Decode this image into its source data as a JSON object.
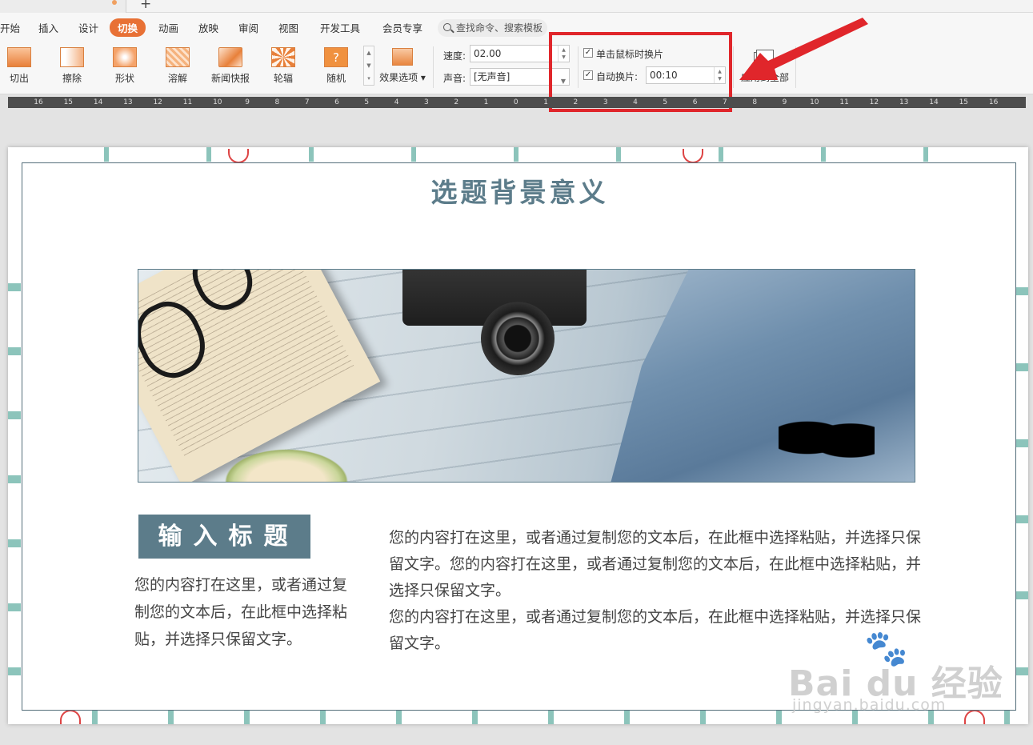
{
  "menu": {
    "items": [
      "开始",
      "插入",
      "设计",
      "切换",
      "动画",
      "放映",
      "审阅",
      "视图",
      "开发工具",
      "会员专享"
    ],
    "active_index": 3,
    "search_placeholder": "查找命令、搜索模板"
  },
  "ribbon": {
    "effects": [
      "切出",
      "擦除",
      "形状",
      "溶解",
      "新闻快报",
      "轮辐",
      "随机"
    ],
    "effect_options_label": "效果选项",
    "speed_label": "速度:",
    "speed_value": "02.00",
    "sound_label": "声音:",
    "sound_value": "[无声音]",
    "on_click_label": "单击鼠标时换片",
    "on_click_checked": true,
    "auto_label": "自动换片:",
    "auto_checked": true,
    "auto_value": "00:10",
    "apply_all_label": "应用到全部"
  },
  "ruler": {
    "ticks": [
      "16",
      "15",
      "14",
      "13",
      "12",
      "11",
      "10",
      "9",
      "8",
      "7",
      "6",
      "5",
      "4",
      "3",
      "2",
      "1",
      "0",
      "1",
      "2",
      "3",
      "4",
      "5",
      "6",
      "7",
      "8",
      "9",
      "10",
      "11",
      "12",
      "13",
      "14",
      "15",
      "16"
    ]
  },
  "slide": {
    "title": "选题背景意义",
    "badge": "输入标题",
    "left_text": "您的内容打在这里，或者通过复制您的文本后，在此框中选择粘贴，并选择只保留文字。",
    "right_para1": "您的内容打在这里，或者通过复制您的文本后，在此框中选择粘贴，并选择只保留文字。您的内容打在这里，或者通过复制您的文本后，在此框中选择粘贴，并选择只保留文字。",
    "right_para2": "您的内容打在这里，或者通过复制您的文本后，在此框中选择粘贴，并选择只保留文字。"
  },
  "watermark": {
    "brand": "Bai du 经验",
    "sub": "jingyan.baidu.com"
  },
  "colors": {
    "accent": "#e87135",
    "highlight": "#e0262b",
    "slide_title": "#5c7c8a"
  }
}
